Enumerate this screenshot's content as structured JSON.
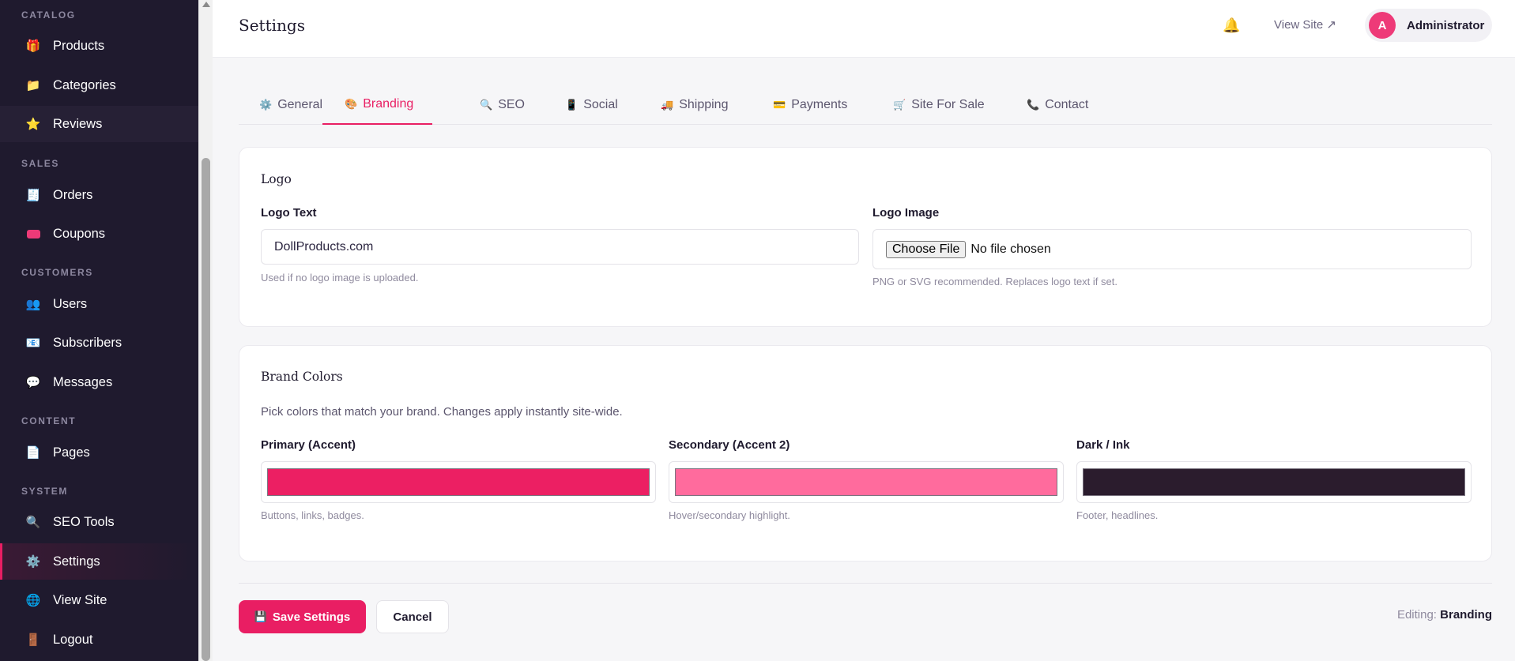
{
  "colors": {
    "accent": "#e91e63",
    "sidebar_bg": "#1f1a2e"
  },
  "sidebar": {
    "sections": {
      "catalog": "CATALOG",
      "sales": "SALES",
      "customers": "CUSTOMERS",
      "content": "CONTENT",
      "system": "SYSTEM"
    },
    "items": [
      {
        "label": "Products",
        "icon": "gift-icon"
      },
      {
        "label": "Categories",
        "icon": "folder-icon"
      },
      {
        "label": "Reviews",
        "icon": "star-icon"
      },
      {
        "label": "Orders",
        "icon": "receipt-icon"
      },
      {
        "label": "Coupons",
        "icon": "ticket-icon"
      },
      {
        "label": "Users",
        "icon": "users-icon"
      },
      {
        "label": "Subscribers",
        "icon": "mail-icon"
      },
      {
        "label": "Messages",
        "icon": "chat-icon"
      },
      {
        "label": "Pages",
        "icon": "page-icon"
      },
      {
        "label": "SEO Tools",
        "icon": "search-icon"
      },
      {
        "label": "Settings",
        "icon": "gear-icon"
      },
      {
        "label": "View Site",
        "icon": "globe-icon"
      },
      {
        "label": "Logout",
        "icon": "door-icon"
      }
    ]
  },
  "header": {
    "title": "Settings",
    "view_site": "View Site ↗",
    "avatar_initial": "A",
    "user_name": "Administrator"
  },
  "tabs": [
    {
      "label": "General",
      "icon": "gear-icon"
    },
    {
      "label": "Branding",
      "icon": "palette-icon"
    },
    {
      "label": "SEO",
      "icon": "search-icon"
    },
    {
      "label": "Social",
      "icon": "phone-icon"
    },
    {
      "label": "Shipping",
      "icon": "truck-icon"
    },
    {
      "label": "Payments",
      "icon": "card-icon"
    },
    {
      "label": "Site For Sale",
      "icon": "cart-icon"
    },
    {
      "label": "Contact",
      "icon": "telephone-icon"
    }
  ],
  "logo_card": {
    "title": "Logo",
    "logo_text_label": "Logo Text",
    "logo_text_value": "DollProducts.com",
    "logo_text_help": "Used if no logo image is uploaded.",
    "logo_image_label": "Logo Image",
    "choose_file": "Choose File",
    "no_file": "No file chosen",
    "logo_image_help": "PNG or SVG recommended. Replaces logo text if set."
  },
  "colors_card": {
    "title": "Brand Colors",
    "description": "Pick colors that match your brand. Changes apply instantly site‑wide.",
    "fields": [
      {
        "label": "Primary (Accent)",
        "color": "#ec1f63",
        "help": "Buttons, links, badges."
      },
      {
        "label": "Secondary (Accent 2)",
        "color": "#ff6b9d",
        "help": "Hover/secondary highlight."
      },
      {
        "label": "Dark / Ink",
        "color": "#2b1c2d",
        "help": "Footer, headlines."
      }
    ]
  },
  "footer": {
    "save": "Save Settings",
    "cancel": "Cancel",
    "editing_label": "Editing:",
    "editing_value": "Branding"
  }
}
